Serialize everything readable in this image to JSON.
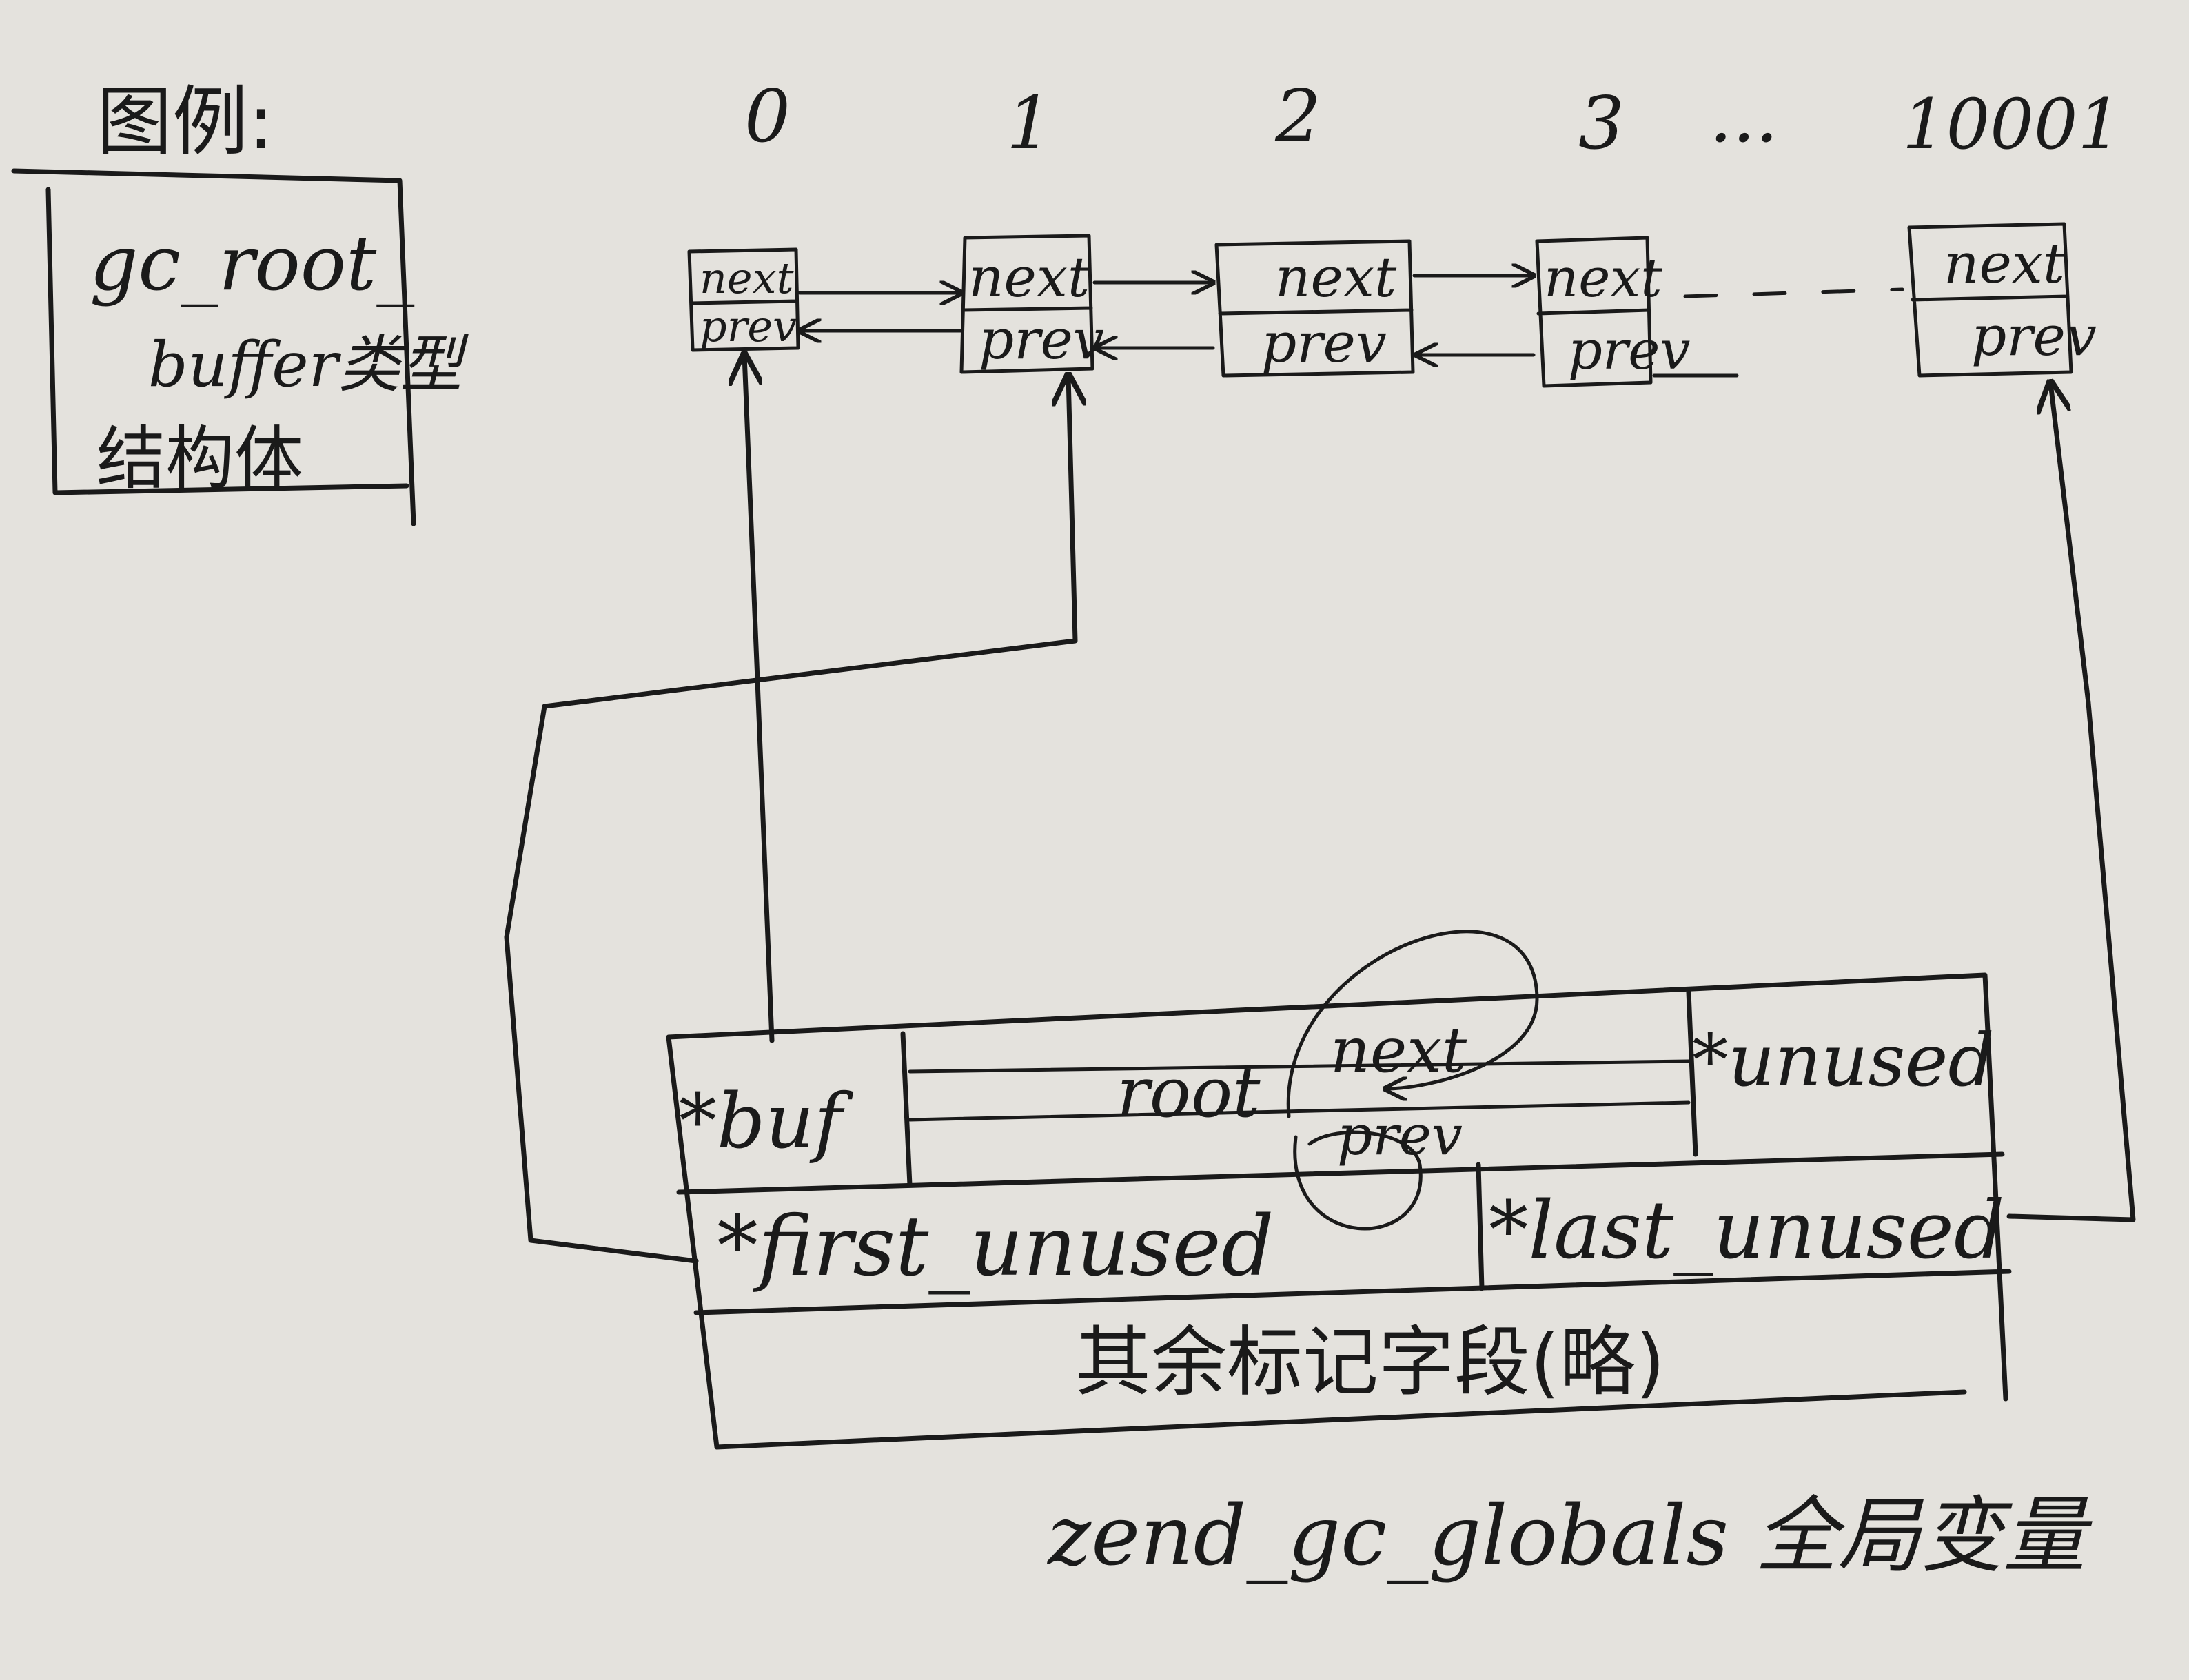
{
  "legend": {
    "title": "图例:",
    "box_line1": "gc_root_",
    "box_line2": "buffer类型",
    "box_line3": "结构体"
  },
  "buffer": {
    "indices": [
      "0",
      "1",
      "2",
      "3",
      "...",
      "10001"
    ],
    "next_label": "next",
    "prev_label": "prev"
  },
  "globals": {
    "buf_field": "*buf",
    "root_field": "root",
    "root_next": "next",
    "root_prev": "prev",
    "unused_field": "*unused",
    "first_unused_field": "*first_unused",
    "last_unused_field": "*last_unused",
    "other_fields": "其余标记字段(略)",
    "caption": "zend_gc_globals 全局变量"
  },
  "colors": {
    "paper": "#e4e2dd",
    "ink": "#1a1a1a"
  }
}
